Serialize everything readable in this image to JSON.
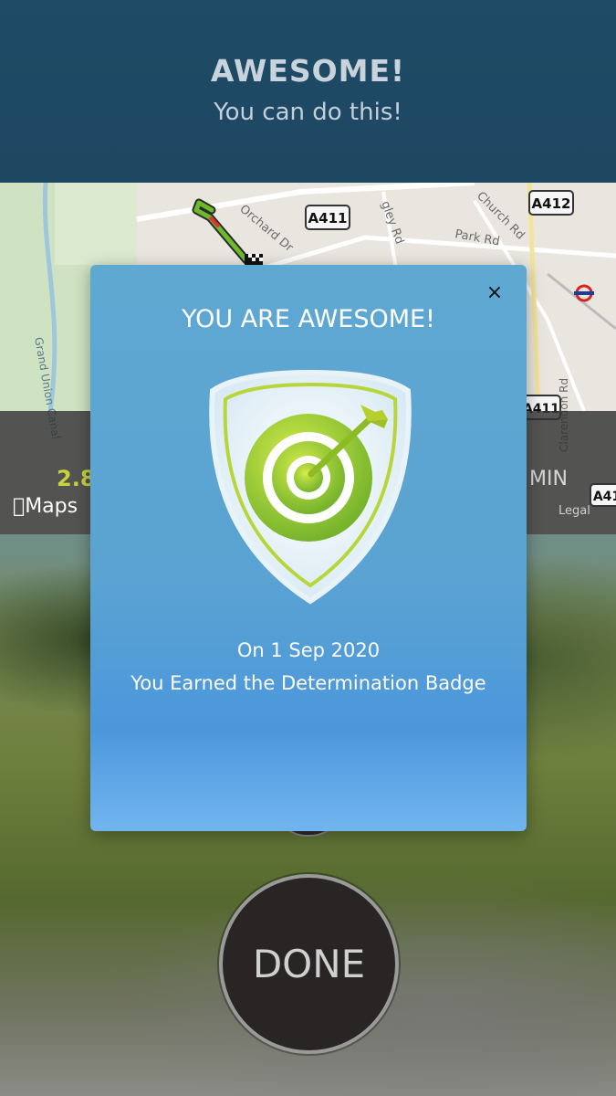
{
  "header": {
    "title": "AWESOME!",
    "subtitle": "You can do this!"
  },
  "map": {
    "road_labels": [
      "A411",
      "A412",
      "A411",
      "A41"
    ],
    "street_labels": [
      "Orchard Dr",
      "gley Rd",
      "Church Rd",
      "Park Rd",
      "Grand Union Canal",
      "Clarendon Rd"
    ],
    "stat_distance": "2.8",
    "stat_time_unit": "MIN",
    "provider": "Maps",
    "legal": "Legal"
  },
  "modal": {
    "close": "×",
    "title": "YOU ARE AWESOME!",
    "date": "On 1 Sep 2020",
    "message": "You Earned the Determination Badge",
    "badge_icon": "target-arrow-icon"
  },
  "done_button": "DONE",
  "colors": {
    "header_bg": "#1f4b66",
    "modal_bg": "#5aa3d2",
    "badge_green": "#8dc21f",
    "done_bg": "#282524"
  }
}
